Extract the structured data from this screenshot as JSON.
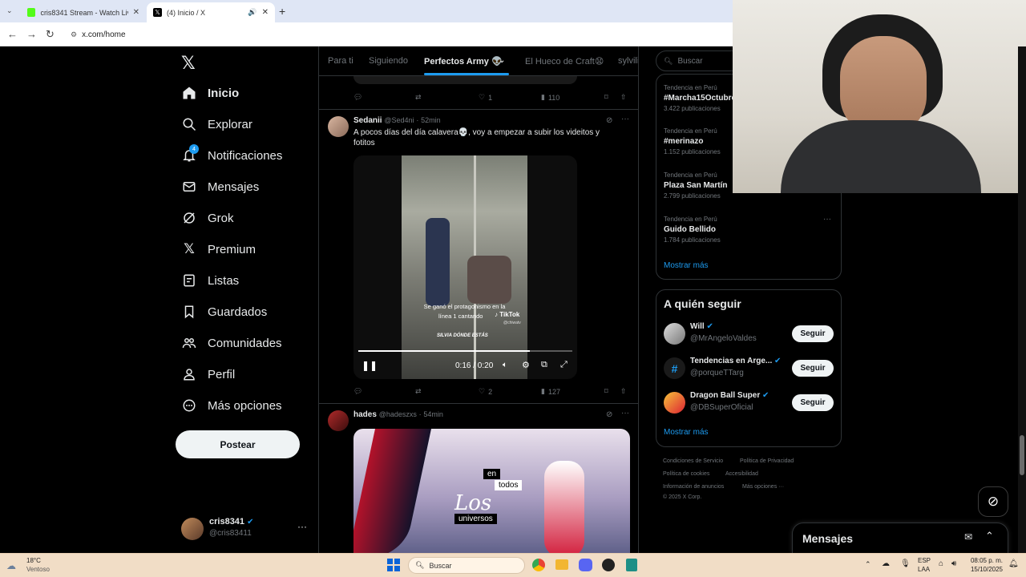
{
  "browser": {
    "tabs": [
      {
        "title": "cris8341 Stream - Watch Live o",
        "favicon_color": "#53fc18"
      },
      {
        "title": "(4) Inicio / X",
        "favicon_color": "#000000"
      }
    ],
    "url": "x.com/home"
  },
  "sidebar": {
    "items": [
      {
        "label": "Inicio",
        "icon": "home-icon"
      },
      {
        "label": "Explorar",
        "icon": "search-icon"
      },
      {
        "label": "Notificaciones",
        "icon": "bell-icon",
        "badge": "4"
      },
      {
        "label": "Mensajes",
        "icon": "envelope-icon"
      },
      {
        "label": "Grok",
        "icon": "grok-icon"
      },
      {
        "label": "Premium",
        "icon": "x-logo-icon"
      },
      {
        "label": "Listas",
        "icon": "list-icon"
      },
      {
        "label": "Guardados",
        "icon": "bookmark-icon"
      },
      {
        "label": "Comunidades",
        "icon": "communities-icon"
      },
      {
        "label": "Perfil",
        "icon": "person-icon"
      },
      {
        "label": "Más opciones",
        "icon": "more-circle-icon"
      }
    ],
    "post_label": "Postear",
    "account": {
      "name": "cris8341",
      "handle": "@cris83411"
    }
  },
  "feed": {
    "tabs": [
      "Para ti",
      "Siguiendo",
      "Perfectos Army 👽",
      "El Hueco de Craft😧",
      "sylvili"
    ],
    "prev_post_actions": {
      "replies": "",
      "reposts": "",
      "likes": "1",
      "views": "110"
    },
    "posts": [
      {
        "name": "Sedanii",
        "handle": "@Sed4ni",
        "time": "52min",
        "text": "A pocos días del día calavera💀, voy a empezar  a subir los videitos y fotitos",
        "video": {
          "caption_line1": "Se ganó el protagonismo en la",
          "caption_line2": "línea 1 cantando",
          "caption_line3": "SILVIA DÓNDE ESTÁS",
          "watermark": "TikTok",
          "watermark_user": "@chiwatv",
          "time": "0:16 / 0:20",
          "progress": 0.8
        },
        "likes": "2",
        "views": "127"
      },
      {
        "name": "hades",
        "handle": "@hadeszxs",
        "time": "54min",
        "image_words": [
          "en",
          "todos",
          "Los",
          "universos"
        ]
      }
    ]
  },
  "right": {
    "search_placeholder": "Buscar",
    "trends": [
      {
        "category": "Tendencia en Perú",
        "name": "#Marcha15Octubre",
        "count": "3.422 publicaciones"
      },
      {
        "category": "Tendencia en Perú",
        "name": "#merinazo",
        "count": "1.152 publicaciones"
      },
      {
        "category": "Tendencia en Perú",
        "name": "Plaza San Martín",
        "count": "2.799 publicaciones"
      },
      {
        "category": "Tendencia en Perú",
        "name": "Guido Bellido",
        "count": "1.784 publicaciones"
      }
    ],
    "show_more": "Mostrar más",
    "who_to_follow_title": "A quién seguir",
    "follow": [
      {
        "name": "Will",
        "handle": "@MrAngeloValdes"
      },
      {
        "name": "Tendencias en Arge...",
        "handle": "@porqueTTarg"
      },
      {
        "name": "Dragon Ball Super",
        "handle": "@DBSuperOficial"
      }
    ],
    "follow_label": "Seguir",
    "footer": [
      "Condiciones de Servicio",
      "Política de Privacidad",
      "Política de cookies",
      "Accesibilidad",
      "Información de anuncios",
      "Más opciones ···",
      "© 2025 X Corp."
    ],
    "messages_label": "Mensajes"
  },
  "taskbar": {
    "weather_temp": "18°C",
    "weather_desc": "Ventoso",
    "search_placeholder": "Buscar",
    "lang1": "ESP",
    "lang2": "LAA",
    "time": "08:05 p. m.",
    "date": "15/10/2025"
  },
  "colors": {
    "accent": "#1d9bf0",
    "background": "#000000",
    "border": "#2f3336",
    "taskbar": "#f1ddc6"
  }
}
